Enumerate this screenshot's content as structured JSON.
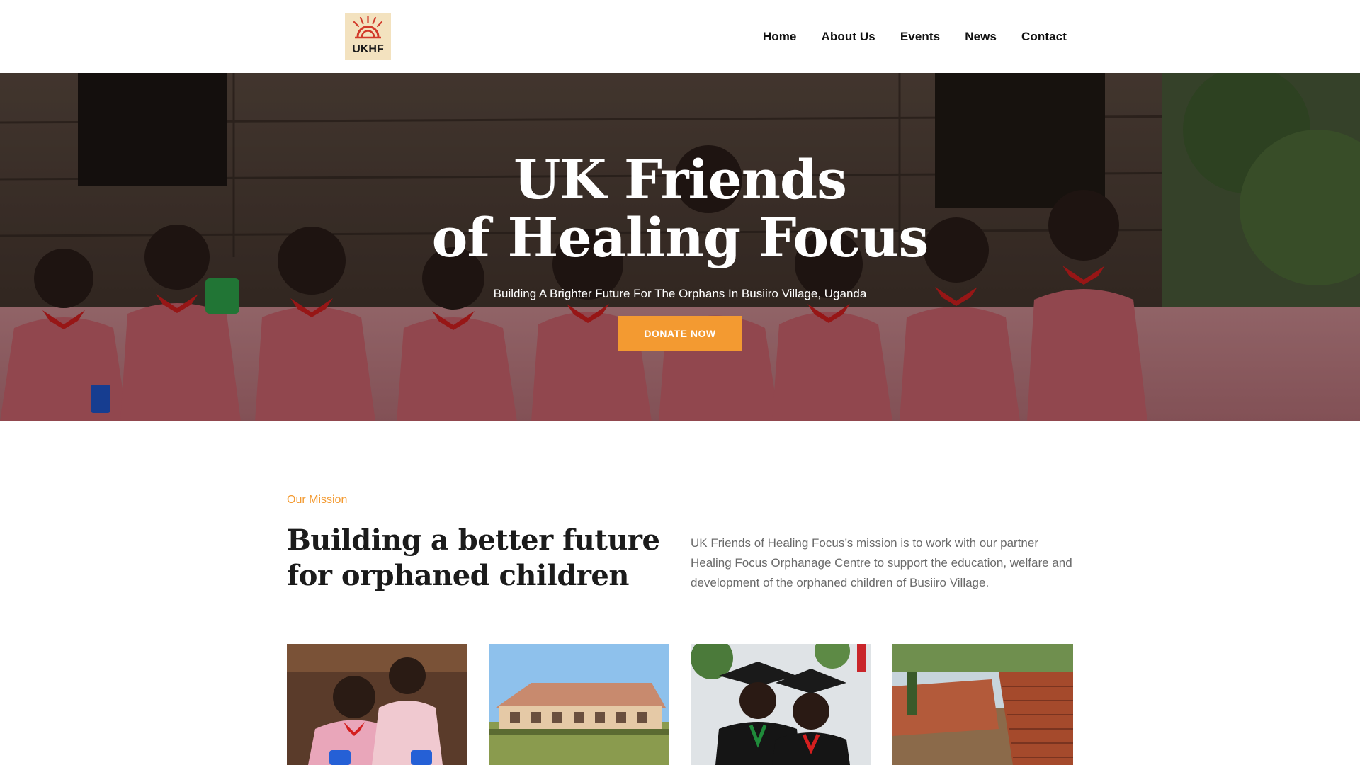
{
  "header": {
    "logo_text": "UKHF",
    "nav": [
      "Home",
      "About Us",
      "Events",
      "News",
      "Contact"
    ]
  },
  "hero": {
    "title_line1": "UK Friends",
    "title_line2": "of Healing Focus",
    "subtitle": "Building A Brighter Future For The Orphans In Busiiro Village, Uganda",
    "donate_label": "DONATE NOW"
  },
  "mission": {
    "eyebrow": "Our Mission",
    "title": "Building a better future for orphaned children",
    "text": "UK Friends of Healing Focus’s mission is to work with our partner Healing Focus Orphanage Centre to support the education, welfare and development of the orphaned children of Busiiro Village."
  },
  "colors": {
    "accent": "#f39a31",
    "logo_bg": "#f3e2bf",
    "logo_red": "#d23a2a"
  },
  "gallery": [
    {
      "name": "children-in-classroom"
    },
    {
      "name": "school-building"
    },
    {
      "name": "graduation-children"
    },
    {
      "name": "brick-construction"
    }
  ]
}
